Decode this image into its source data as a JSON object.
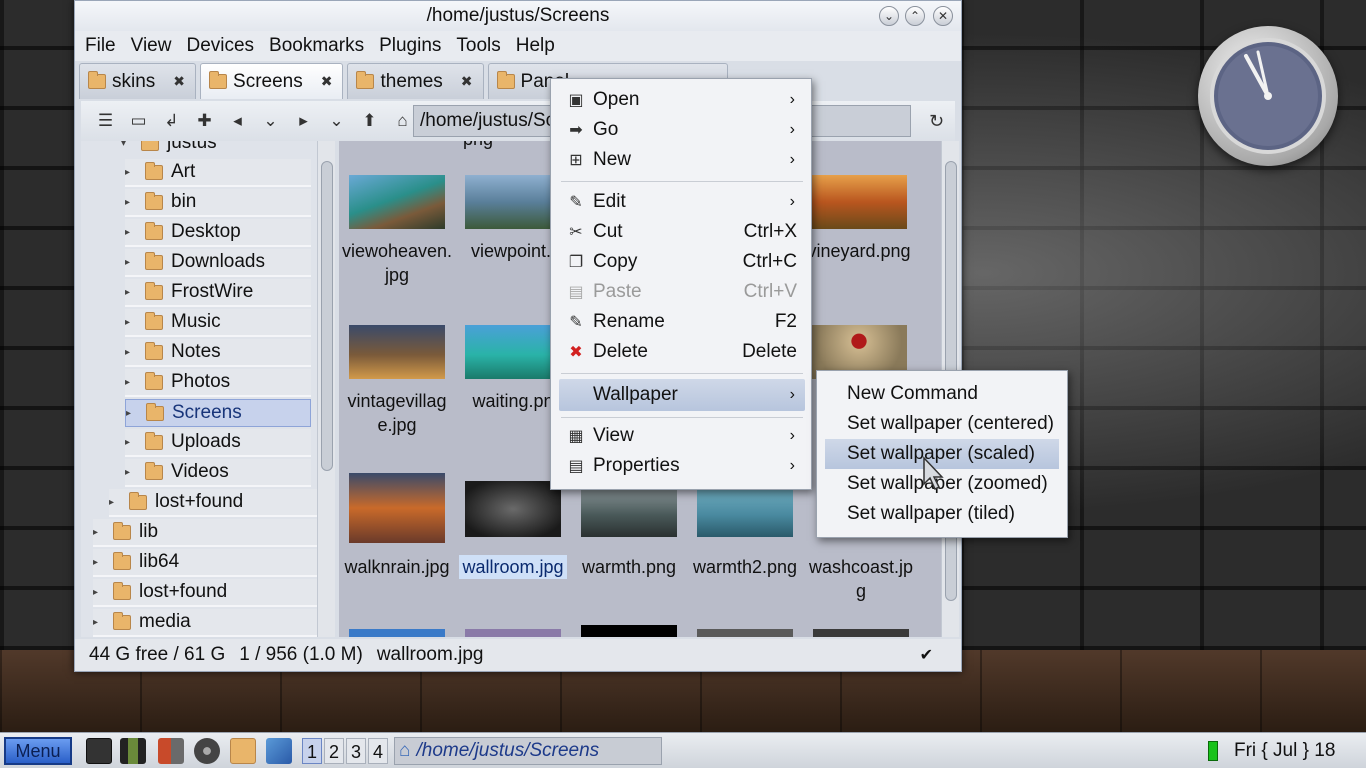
{
  "window": {
    "title": "/home/justus/Screens",
    "menu": [
      "File",
      "View",
      "Devices",
      "Bookmarks",
      "Plugins",
      "Tools",
      "Help"
    ],
    "tabs": [
      {
        "label": "skins",
        "active": false
      },
      {
        "label": "Screens",
        "active": true
      },
      {
        "label": "themes",
        "active": false
      },
      {
        "label": "Panel",
        "active": false
      }
    ],
    "path": "/home/justus/Screens"
  },
  "tree": {
    "partial_top": "justus",
    "items": [
      {
        "label": "Art",
        "selected": false
      },
      {
        "label": "bin",
        "selected": false
      },
      {
        "label": "Desktop",
        "selected": false
      },
      {
        "label": "Downloads",
        "selected": false
      },
      {
        "label": "FrostWire",
        "selected": false
      },
      {
        "label": "Music",
        "selected": false
      },
      {
        "label": "Notes",
        "selected": false
      },
      {
        "label": "Photos",
        "selected": false
      },
      {
        "label": "Screens",
        "selected": true
      },
      {
        "label": "Uploads",
        "selected": false
      },
      {
        "label": "Videos",
        "selected": false
      }
    ],
    "lower_items": [
      "lost+found",
      "lib",
      "lib64",
      "lost+found",
      "media"
    ]
  },
  "files": {
    "row1": [
      "viewoheaven.\njpg",
      "viewpoint.j",
      "vineyard.png"
    ],
    "row2": [
      "vintagevillag\ne.jpg",
      "waiting.pn"
    ],
    "row3": [
      "walknrain.jpg",
      "wallroom.jpg",
      "warmth.png",
      "warmth2.png",
      "washcoast.jp\ng"
    ],
    "selected": "wallroom.jpg",
    "partial_top_label": "png"
  },
  "status": {
    "free": "44 G free / 61 G",
    "count": "1 / 956 (1.0 M)",
    "file": "wallroom.jpg"
  },
  "context_menu": [
    {
      "label": "Open",
      "shortcut": "",
      "submenu": true,
      "icon": "open-icon"
    },
    {
      "label": "Go",
      "shortcut": "",
      "submenu": true,
      "icon": "go-icon"
    },
    {
      "label": "New",
      "shortcut": "",
      "submenu": true,
      "icon": "new-icon"
    },
    {
      "label": "Edit",
      "shortcut": "",
      "submenu": true,
      "icon": "edit-icon"
    },
    {
      "label": "Cut",
      "shortcut": "Ctrl+X",
      "submenu": false,
      "icon": "cut-icon"
    },
    {
      "label": "Copy",
      "shortcut": "Ctrl+C",
      "submenu": false,
      "icon": "copy-icon"
    },
    {
      "label": "Paste",
      "shortcut": "Ctrl+V",
      "submenu": false,
      "icon": "paste-icon",
      "disabled": true
    },
    {
      "label": "Rename",
      "shortcut": "F2",
      "submenu": false,
      "icon": "rename-icon"
    },
    {
      "label": "Delete",
      "shortcut": "Delete",
      "submenu": false,
      "icon": "delete-icon"
    },
    {
      "label": "Wallpaper",
      "shortcut": "",
      "submenu": true,
      "icon": "",
      "highlighted": true
    },
    {
      "label": "View",
      "shortcut": "",
      "submenu": true,
      "icon": "view-icon"
    },
    {
      "label": "Properties",
      "shortcut": "",
      "submenu": true,
      "icon": "properties-icon"
    }
  ],
  "wallpaper_submenu": [
    "New Command",
    "Set wallpaper (centered)",
    "Set wallpaper (scaled)",
    "Set wallpaper (zoomed)",
    "Set wallpaper (tiled)"
  ],
  "taskbar": {
    "menu_label": "Menu",
    "desktops": [
      "1",
      "2",
      "3",
      "4"
    ],
    "active_desktop": "1",
    "task": "/home/justus/Screens",
    "datetime": "Fri { Jul } 18"
  },
  "colors": {
    "selection": "#c7d2ec",
    "menu_highlight": "#b7c5dd",
    "battery": "#18c21a",
    "delete_icon": "#d22020"
  }
}
